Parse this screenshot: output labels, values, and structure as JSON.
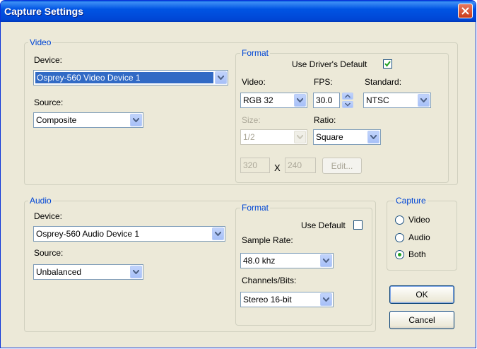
{
  "window": {
    "title": "Capture Settings"
  },
  "video": {
    "legend": "Video",
    "device_label": "Device:",
    "device_value": "Osprey-560 Video Device 1",
    "source_label": "Source:",
    "source_value": "Composite",
    "format": {
      "legend": "Format",
      "use_driver_default_label": "Use Driver's Default",
      "use_driver_default_checked": true,
      "video_label": "Video:",
      "video_value": "RGB 32",
      "fps_label": "FPS:",
      "fps_value": "30.0",
      "standard_label": "Standard:",
      "standard_value": "NTSC",
      "size_label": "Size:",
      "size_value": "1/2",
      "ratio_label": "Ratio:",
      "ratio_value": "Square",
      "width_value": "320",
      "x_label": "X",
      "height_value": "240",
      "edit_label": "Edit..."
    }
  },
  "audio": {
    "legend": "Audio",
    "device_label": "Device:",
    "device_value": "Osprey-560 Audio Device 1",
    "source_label": "Source:",
    "source_value": "Unbalanced",
    "format": {
      "legend": "Format",
      "use_default_label": "Use Default",
      "use_default_checked": false,
      "sample_rate_label": "Sample Rate:",
      "sample_rate_value": "48.0 khz",
      "channels_bits_label": "Channels/Bits:",
      "channels_bits_value": "Stereo 16-bit"
    }
  },
  "capture": {
    "legend": "Capture",
    "options": [
      "Video",
      "Audio",
      "Both"
    ],
    "selected": "Both"
  },
  "buttons": {
    "ok": "OK",
    "cancel": "Cancel"
  },
  "colors": {
    "title_bar": "#0054e3",
    "window_bg": "#ece9d8",
    "selection": "#316ac5",
    "close": "#c93b1a",
    "legend_text": "#0046d5"
  }
}
